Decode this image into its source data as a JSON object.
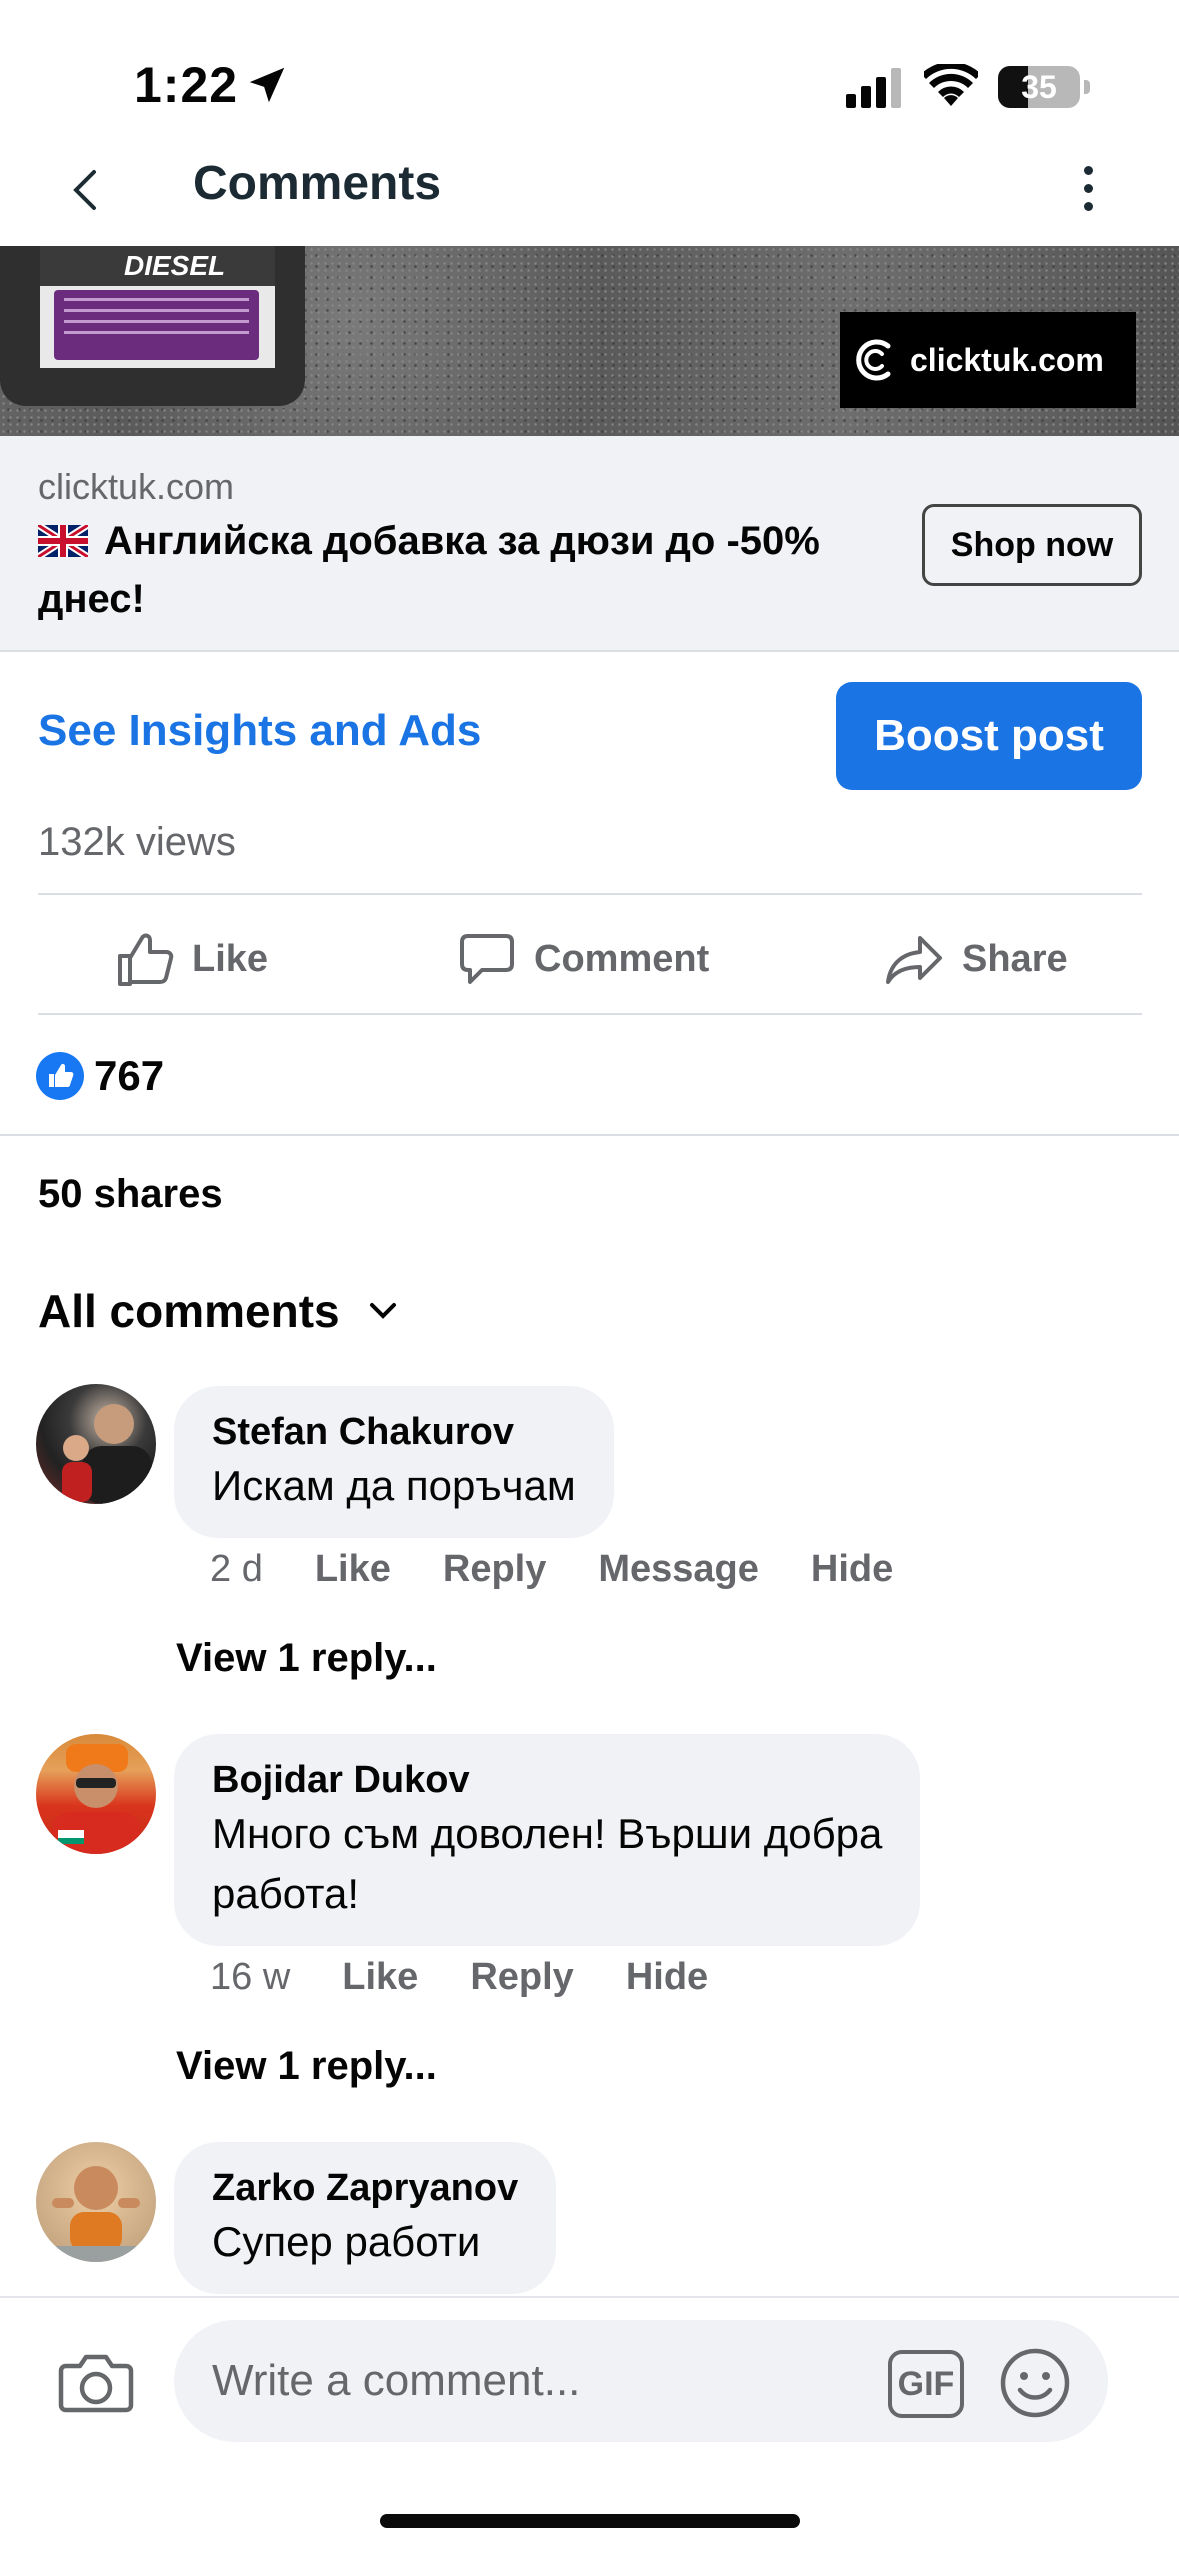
{
  "status_bar": {
    "time": "1:22",
    "battery": "35"
  },
  "header": {
    "title": "Comments"
  },
  "ad": {
    "product_label": "DIESEL",
    "brand_badge": "clicktuk.com",
    "domain": "clicktuk.com",
    "headline_flag": "🇬🇧",
    "headline": "Английска добавка за дюзи до -50% днес!",
    "cta": "Shop now"
  },
  "insights": {
    "link_label": "See Insights and Ads",
    "boost_label": "Boost post"
  },
  "stats": {
    "views": "132k views",
    "reaction_count": "767",
    "shares": "50 shares"
  },
  "actions": {
    "like": "Like",
    "comment": "Comment",
    "share": "Share"
  },
  "comments_filter": {
    "label": "All comments"
  },
  "comments": [
    {
      "name": "Stefan Chakurov",
      "text": "Искам да поръчам",
      "time": "2 d",
      "like": "Like",
      "reply": "Reply",
      "message": "Message",
      "hide": "Hide",
      "view_replies": "View 1 reply..."
    },
    {
      "name": "Bojidar Dukov",
      "text_line1": "Много съм доволен! Върши добра",
      "text_line2": "работа!",
      "time": "16 w",
      "like": "Like",
      "reply": "Reply",
      "hide": "Hide",
      "view_replies": "View 1 reply..."
    },
    {
      "name": "Zarko Zapryanov",
      "text": "Супер работи"
    }
  ],
  "composer": {
    "placeholder": "Write a comment...",
    "gif_label": "GIF"
  },
  "colors": {
    "accent": "#1b74e4",
    "secondary_text": "#65676b",
    "bubble": "#f0f2f5"
  }
}
